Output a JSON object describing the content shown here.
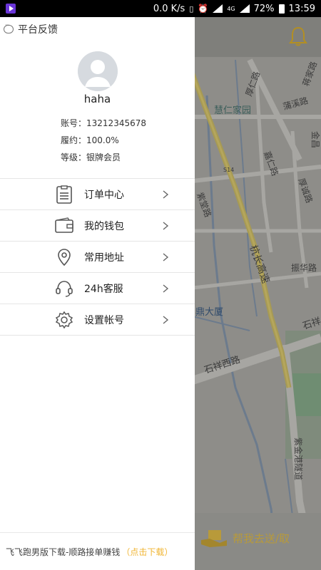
{
  "status_bar": {
    "speed": "0.0 K/s",
    "network": "4G",
    "battery": "72%",
    "time": "13:59"
  },
  "drawer": {
    "feedback_label": "平台反馈",
    "username": "haha",
    "info": [
      {
        "key": "账号：",
        "value": "13212345678"
      },
      {
        "key": "履约：",
        "value": "100.0%"
      },
      {
        "key": "等级：",
        "value": "银牌会员"
      }
    ],
    "menu": [
      {
        "label": "订单中心",
        "icon": "clipboard-icon"
      },
      {
        "label": "我的钱包",
        "icon": "wallet-icon"
      },
      {
        "label": "常用地址",
        "icon": "location-pin-icon"
      },
      {
        "label": "24h客服",
        "icon": "headset-icon"
      },
      {
        "label": "设置帐号",
        "icon": "gear-icon"
      }
    ],
    "footer": {
      "text": "飞飞跑男版下载-顺路接单赚钱",
      "link": "（点击下载）"
    }
  },
  "map": {
    "labels": [
      "厚仁路",
      "蒋家路",
      "蒲溪路",
      "慧仁家园",
      "金昌",
      "嘉仁路",
      "S14",
      "厚诚路",
      "紫堂路",
      "杭长高速",
      "振华路",
      "鼎大厦",
      "石祥",
      "石祥西路",
      "紫金港隧道"
    ]
  },
  "action_bar": {
    "send_label": "帮我去送/取"
  },
  "colors": {
    "accent": "#f0b533",
    "drawer_bg": "#ffffff",
    "map_overlay": "#8d8c88"
  }
}
